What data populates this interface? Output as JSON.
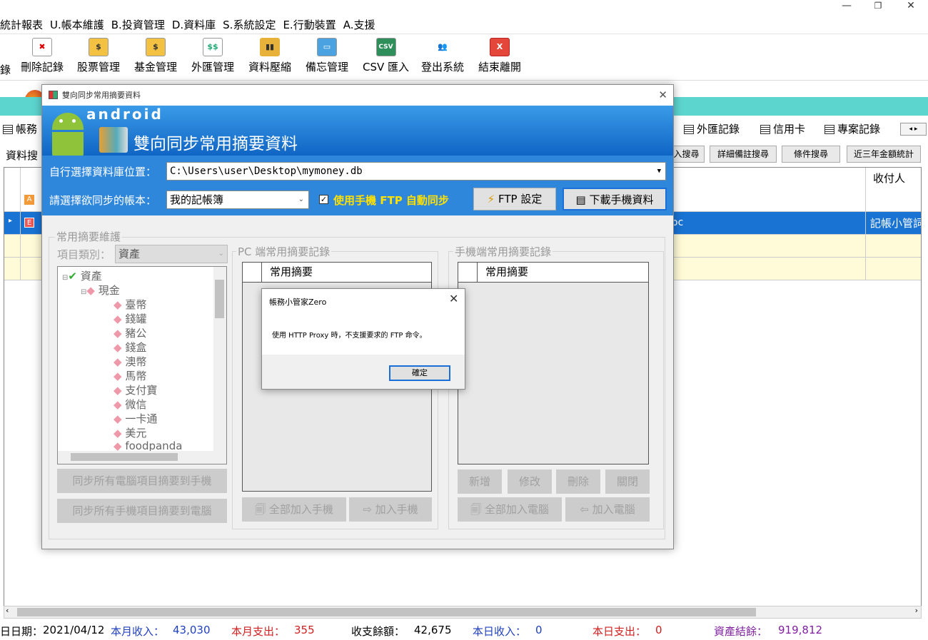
{
  "window": {
    "minimize": "—",
    "maximize": "❐",
    "close": "✕"
  },
  "menu": [
    "統計報表",
    "U.帳本維護",
    "B.投資管理",
    "D.資料庫",
    "S.系統設定",
    "E.行動裝置",
    "A.支援"
  ],
  "toolbar": [
    {
      "label": "錄",
      "icon": "partial-icon"
    },
    {
      "label": "刪除記錄",
      "icon": "delete-icon",
      "glyph": "✖"
    },
    {
      "label": "股票管理",
      "icon": "stock-icon",
      "glyph": "$"
    },
    {
      "label": "基金管理",
      "icon": "fund-icon",
      "glyph": "$"
    },
    {
      "label": "外匯管理",
      "icon": "forex-icon",
      "glyph": "$$"
    },
    {
      "label": "資料壓縮",
      "icon": "compress-icon",
      "glyph": "▮▮"
    },
    {
      "label": "備忘管理",
      "icon": "memo-icon",
      "glyph": "▭"
    },
    {
      "label": "CSV 匯入",
      "icon": "csv-icon",
      "glyph": "CSV"
    },
    {
      "label": "登出系統",
      "icon": "logout-icon",
      "glyph": "👥"
    },
    {
      "label": "結束離開",
      "icon": "exit-icon",
      "glyph": "X"
    }
  ],
  "tabs": {
    "left": "帳務",
    "t1": "外匯記錄",
    "t2": "信用卡",
    "t3": "專案記錄"
  },
  "search": {
    "label": "資料搜",
    "b1": "入搜尋",
    "b2": "詳細備註搜尋",
    "b3": "條件搜尋",
    "b4": "近三年金額統計"
  },
  "grid": {
    "col_payee": "收付人",
    "row_a": "A",
    "row_e": "E",
    "selected_frag": "oc",
    "selected_payee": "記帳小管詞"
  },
  "status": {
    "date_label": "日日期：",
    "date": "2021/04/12",
    "month_income_label": "本月收入：",
    "month_income": "43,030",
    "month_expense_label": "本月支出：",
    "month_expense": "355",
    "balance_label": "收支餘額：",
    "balance": "42,675",
    "day_income_label": "本日收入：",
    "day_income": "0",
    "day_expense_label": "本日支出：",
    "day_expense": "0",
    "assets_label": "資產結餘：",
    "assets": "919,812"
  },
  "dialog": {
    "title": "雙向同步常用摘要資料",
    "brand": "android",
    "heading": "雙向同步常用摘要資料",
    "db_label": "自行選擇資料庫位置：",
    "db_path": "C:\\Users\\user\\Desktop\\mymoney.db",
    "book_label": "請選擇欲同步的帳本：",
    "book_value": "我的記帳簿",
    "auto_sync": "使用手機 FTP 自動同步",
    "ftp_button": "FTP 設定",
    "download_button": "下載手機資料",
    "group_maint": "常用摘要維護",
    "category_label": "項目類別：",
    "category_value": "資產",
    "tree": [
      "資產",
      "現金",
      "臺幣",
      "錢罐",
      "豬公",
      "錢盒",
      "澳幣",
      "馬幣",
      "支付寶",
      "微信",
      "一卡通",
      "美元",
      "foodpanda"
    ],
    "sync_to_phone": "同步所有電腦項目摘要到手機",
    "sync_to_pc": "同步所有手機項目摘要到電腦",
    "group_pc": "PC 端常用摘要記錄",
    "group_phone": "手機端常用摘要記錄",
    "col_summary": "常用摘要",
    "add_all_phone": "全部加入手機",
    "add_phone": "加入手機",
    "btn_new": "新增",
    "btn_edit": "修改",
    "btn_delete": "刪除",
    "btn_close": "關閉",
    "add_all_pc": "全部加入電腦",
    "add_pc": "加入電腦"
  },
  "alert": {
    "title": "帳務小管家Zero",
    "message": "使用 HTTP Proxy 時，不支援要求的 FTP 命令。",
    "ok": "確定"
  }
}
